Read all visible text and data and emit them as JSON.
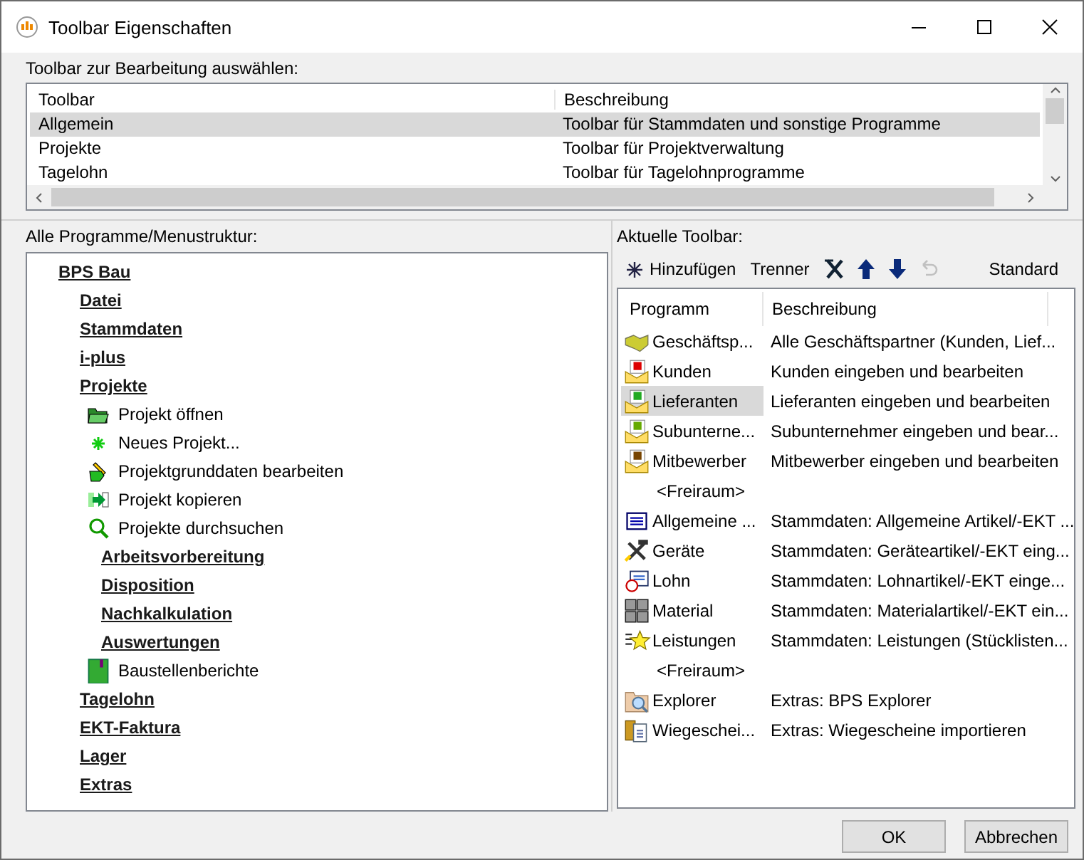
{
  "window": {
    "title": "Toolbar Eigenschaften"
  },
  "toolbar_picker": {
    "label": "Toolbar zur Bearbeitung auswählen:",
    "columns": [
      "Toolbar",
      "Beschreibung"
    ],
    "rows": [
      {
        "name": "Allgemein",
        "description": "Toolbar für Stammdaten und sonstige Programme",
        "selected": true
      },
      {
        "name": "Projekte",
        "description": "Toolbar für Projektverwaltung",
        "selected": false
      },
      {
        "name": "Tagelohn",
        "description": "Toolbar für Tagelohnprogramme",
        "selected": false
      }
    ]
  },
  "all_programs": {
    "label": "Alle Programme/Menustruktur:",
    "tree": [
      {
        "label": "BPS Bau",
        "kind": "menu",
        "children": [
          {
            "label": "Datei",
            "kind": "menu"
          },
          {
            "label": "Stammdaten",
            "kind": "menu"
          },
          {
            "label": "i-plus",
            "kind": "menu"
          },
          {
            "label": "Projekte",
            "kind": "menu",
            "children": [
              {
                "label": "Projekt öffnen",
                "kind": "program"
              },
              {
                "label": "Neues Projekt...",
                "kind": "program"
              },
              {
                "label": "Projektgrunddaten bearbeiten",
                "kind": "program"
              },
              {
                "label": "Projekt kopieren",
                "kind": "program"
              },
              {
                "label": "Projekte durchsuchen",
                "kind": "program"
              },
              {
                "label": "Arbeitsvorbereitung",
                "kind": "menu"
              },
              {
                "label": "Disposition",
                "kind": "menu"
              },
              {
                "label": "Nachkalkulation",
                "kind": "menu"
              },
              {
                "label": "Auswertungen",
                "kind": "menu"
              },
              {
                "label": "Baustellenberichte",
                "kind": "program"
              }
            ]
          },
          {
            "label": "Tagelohn",
            "kind": "menu"
          },
          {
            "label": "EKT-Faktura",
            "kind": "menu"
          },
          {
            "label": "Lager",
            "kind": "menu"
          },
          {
            "label": "Extras",
            "kind": "menu"
          }
        ]
      }
    ]
  },
  "current_toolbar": {
    "label": "Aktuelle Toolbar:",
    "add_button": "Hinzufügen",
    "separator_button": "Trenner",
    "tools": [
      {
        "disabled": false
      },
      {
        "disabled": false
      },
      {
        "disabled": false
      },
      {
        "disabled": true
      }
    ],
    "standard_button": "Standard",
    "columns": [
      "Programm",
      "Beschreibung"
    ],
    "rows": [
      {
        "kind": "program",
        "program": "Geschäftsp...",
        "description": "Alle Geschäftspartner (Kunden, Lief...",
        "selected": false
      },
      {
        "kind": "program",
        "program": "Kunden",
        "description": "Kunden eingeben und bearbeiten",
        "selected": false
      },
      {
        "kind": "program",
        "program": "Lieferanten",
        "description": "Lieferanten eingeben und bearbeiten",
        "selected": true
      },
      {
        "kind": "program",
        "program": "Subunterne...",
        "description": "Subunternehmer eingeben und bear...",
        "selected": false
      },
      {
        "kind": "program",
        "program": "Mitbewerber",
        "description": "Mitbewerber eingeben und bearbeiten",
        "selected": false
      },
      {
        "kind": "spacer",
        "program": "<Freiraum>",
        "selected": false
      },
      {
        "kind": "program",
        "program": "Allgemeine ...",
        "description": "Stammdaten: Allgemeine Artikel/-EKT ...",
        "selected": false
      },
      {
        "kind": "program",
        "program": "Geräte",
        "description": "Stammdaten: Geräteartikel/-EKT eing...",
        "selected": false
      },
      {
        "kind": "program",
        "program": "Lohn",
        "description": "Stammdaten: Lohnartikel/-EKT einge...",
        "selected": false
      },
      {
        "kind": "program",
        "program": "Material",
        "description": "Stammdaten: Materialartikel/-EKT ein...",
        "selected": false
      },
      {
        "kind": "program",
        "program": "Leistungen",
        "description": "Stammdaten: Leistungen (Stücklisten...",
        "selected": false
      },
      {
        "kind": "spacer",
        "program": "<Freiraum>",
        "selected": false
      },
      {
        "kind": "program",
        "program": "Explorer",
        "description": "Extras: BPS Explorer",
        "selected": false
      },
      {
        "kind": "program",
        "program": "Wiegeschei...",
        "description": "Extras: Wiegescheine importieren",
        "selected": false
      }
    ]
  },
  "buttons": [
    {
      "label": "OK"
    },
    {
      "label": "Abbrechen"
    }
  ]
}
